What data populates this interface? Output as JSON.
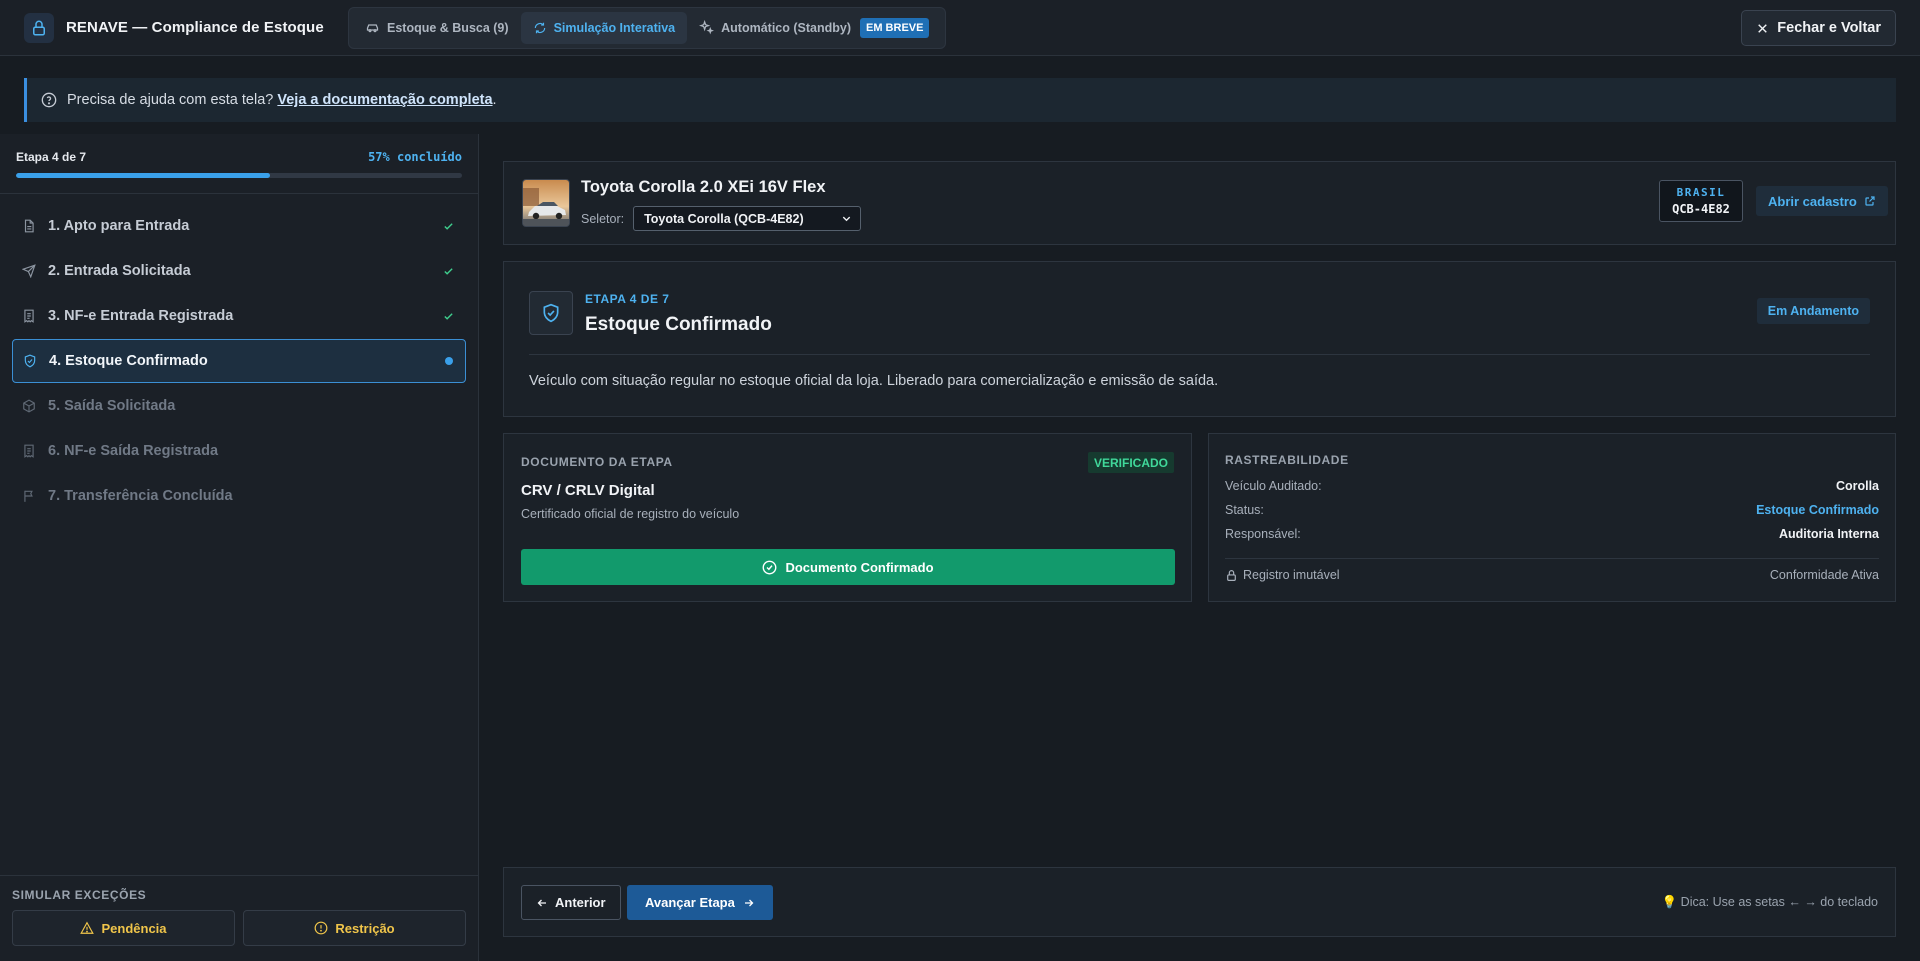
{
  "app": {
    "title": "RENAVE — Compliance de Estoque",
    "accent": "#4eb2f0"
  },
  "nav": {
    "tabs": [
      {
        "label": "Estoque & Busca (9)",
        "icon": "car-icon"
      },
      {
        "label": "Simulação Interativa",
        "icon": "refresh-icon",
        "active": true
      },
      {
        "label": "Automático (Standby)",
        "icon": "sparkles-icon",
        "badge": "EM BREVE"
      }
    ],
    "close_label": "Fechar e Voltar"
  },
  "help": {
    "text": "Precisa de ajuda com esta tela?",
    "link": "Veja a documentação completa",
    "suffix": "."
  },
  "sidebar": {
    "progress_label": "Etapa 4 de 7",
    "progress_pct_label": "57% concluído",
    "progress_value": 0.57,
    "steps": [
      {
        "label": "1. Apto para Entrada",
        "state": "done",
        "icon": "document-icon"
      },
      {
        "label": "2. Entrada Solicitada",
        "state": "done",
        "icon": "send-icon"
      },
      {
        "label": "3. NF-e Entrada Registrada",
        "state": "done",
        "icon": "receipt-icon"
      },
      {
        "label": "4. Estoque Confirmado",
        "state": "active",
        "icon": "shield-check-icon"
      },
      {
        "label": "5. Saída Solicitada",
        "state": "pending",
        "icon": "package-icon"
      },
      {
        "label": "6. NF-e Saída Registrada",
        "state": "pending",
        "icon": "receipt-icon"
      },
      {
        "label": "7. Transferência Concluída",
        "state": "pending",
        "icon": "flag-icon"
      }
    ],
    "sim_title": "SIMULAR EXCEÇÕES",
    "sim_buttons": [
      {
        "label": "Pendência",
        "icon": "warning-icon"
      },
      {
        "label": "Restrição",
        "icon": "alert-circle-icon"
      }
    ]
  },
  "vehicle": {
    "title": "Toyota Corolla 2.0 XEi 16V Flex",
    "selector_label": "Seletor:",
    "selector_value": "Toyota Corolla (QCB-4E82)",
    "plate_country": "BRASIL",
    "plate_number": "QCB-4E82",
    "open_label": "Abrir cadastro"
  },
  "stage": {
    "kicker": "ETAPA 4 DE 7",
    "title": "Estoque Confirmado",
    "status": "Em Andamento",
    "description": "Veículo com situação regular no estoque oficial da loja. Liberado para comercialização e emissão de saída."
  },
  "document": {
    "section": "DOCUMENTO DA ETAPA",
    "badge": "VERIFICADO",
    "name": "CRV / CRLV Digital",
    "subtitle": "Certificado oficial de registro do veículo",
    "button": "Documento Confirmado"
  },
  "trace": {
    "section": "RASTREABILIDADE",
    "rows": [
      {
        "k": "Veículo Auditado:",
        "v": "Corolla"
      },
      {
        "k": "Status:",
        "v": "Estoque Confirmado"
      },
      {
        "k": "Responsável:",
        "v": "Auditoria Interna"
      }
    ],
    "footer_left": "Registro imutável",
    "footer_right": "Conformidade Ativa"
  },
  "footer": {
    "prev": "Anterior",
    "next": "Avançar Etapa",
    "tip": "💡 Dica: Use as setas ← → do teclado"
  }
}
